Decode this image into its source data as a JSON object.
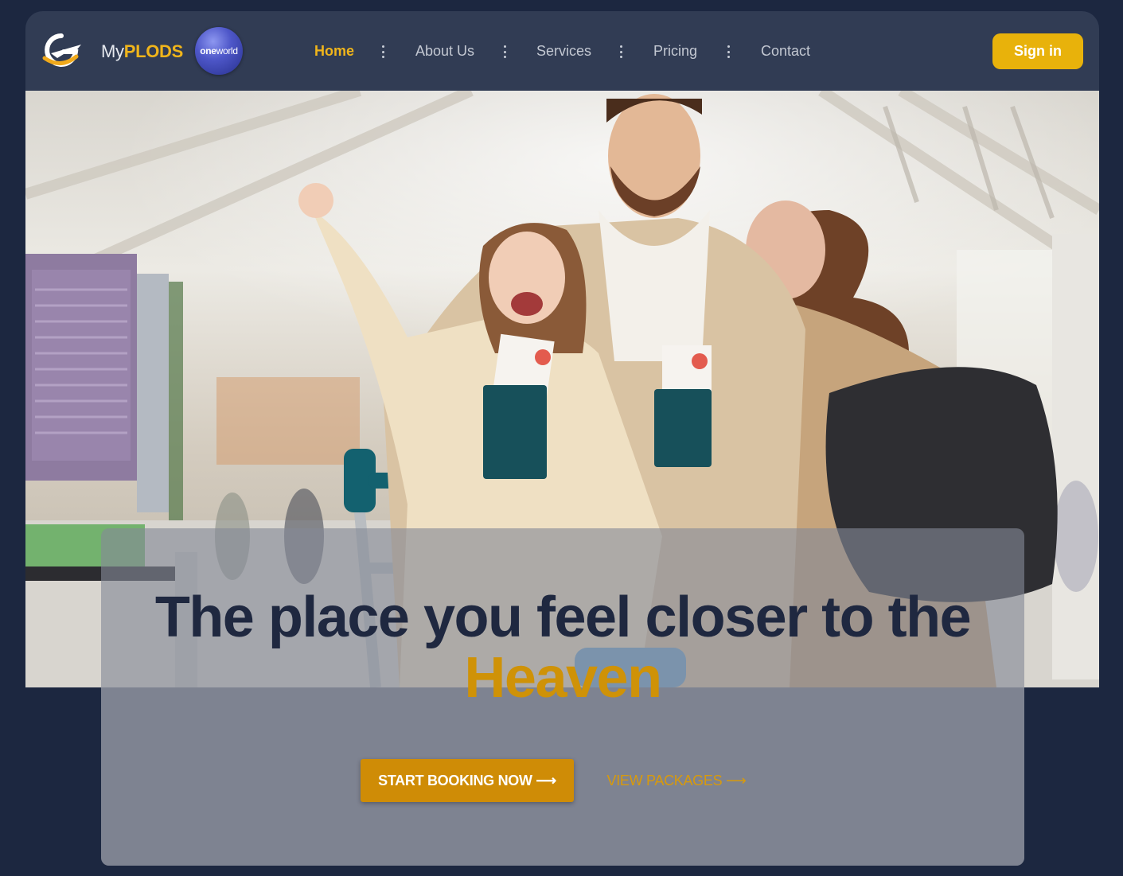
{
  "brand": {
    "prefix": "My",
    "name": "PLODS",
    "partner_badge_bold": "one",
    "partner_badge_rest": "world"
  },
  "nav": {
    "items": [
      {
        "label": "Home",
        "active": true
      },
      {
        "label": "About Us",
        "active": false
      },
      {
        "label": "Services",
        "active": false
      },
      {
        "label": "Pricing",
        "active": false
      },
      {
        "label": "Contact",
        "active": false
      }
    ],
    "separator_icon": "vertical-dots-icon"
  },
  "signin_label": "Sign in",
  "hero": {
    "image": "family-at-airport-photo",
    "headline_main": "The place you feel closer to the",
    "headline_accent": "Heaven",
    "primary_cta": "START BOOKING NOW ⟶",
    "secondary_cta": "VIEW PACKAGES ⟶"
  },
  "colors": {
    "page_bg": "#1c2740",
    "navbar_bg": "#313c54",
    "accent": "#f0b51b",
    "cta": "#cf8c06",
    "headline": "#1f2840"
  }
}
